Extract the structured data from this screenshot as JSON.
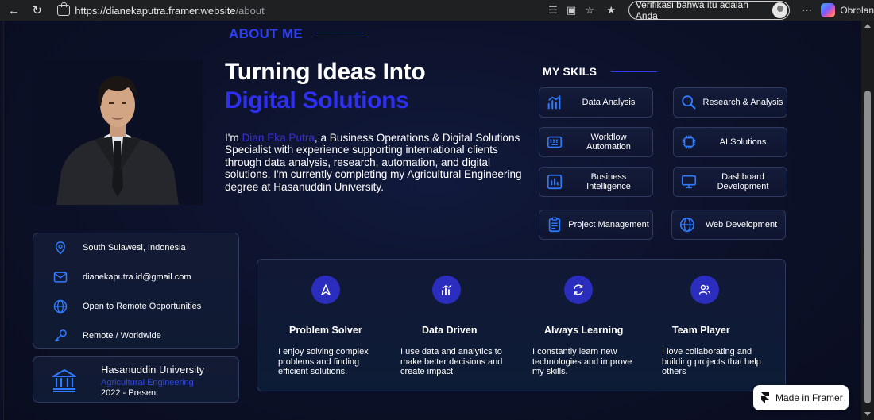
{
  "browser": {
    "url_host": "https://dianekaputra.framer.website",
    "url_path": "/about",
    "verify_label": "Verifikasi bahwa itu adalah Anda",
    "copilot_label": "Obrolan"
  },
  "about": {
    "section_title": "ABOUT ME",
    "headline_line1": "Turning Ideas Into",
    "headline_line2": "Digital Solutions",
    "bio_prefix": "I'm ",
    "bio_name": "Dian Eka Putra",
    "bio_text": ", a Business Operations & Digital Solutions Specialist with experience supporting international clients through data analysis, research, automation, and digital solutions. I'm currently completing my Agricultural Engineering degree at Hasanuddin University."
  },
  "skills": {
    "title": "MY SKILS",
    "items": [
      {
        "label": "Data Analysis",
        "icon": "chart-icon"
      },
      {
        "label": "Research & Analysis",
        "icon": "search-icon"
      },
      {
        "label": "Workflow Automation",
        "icon": "keyboard-icon"
      },
      {
        "label": "AI Solutions",
        "icon": "chip-icon"
      },
      {
        "label": "Business Intelligence",
        "icon": "bar-chart-icon"
      },
      {
        "label": "Dashboard Development",
        "icon": "monitor-icon"
      },
      {
        "label": "Project Management",
        "icon": "clipboard-icon"
      },
      {
        "label": "Web Development",
        "icon": "globe-icon"
      }
    ]
  },
  "contact": {
    "location": "South Sulawesi, Indonesia",
    "email": "dianekaputra.id@gmail.com",
    "availability": "Open to Remote Opportunities",
    "work_mode": "Remote / Worldwide"
  },
  "education": {
    "school": "Hasanuddin University",
    "major": "Agricultural Engineering",
    "years": "2022 - Present"
  },
  "traits": [
    {
      "title": "Problem Solver",
      "desc": "I enjoy solving complex problems and finding efficient solutions.",
      "icon": "compass-icon"
    },
    {
      "title": "Data Driven",
      "desc": "I use data and analytics to make better decisions and create impact.",
      "icon": "chart-icon"
    },
    {
      "title": "Always Learning",
      "desc": "I constantly learn new technologies and improve my skills.",
      "icon": "refresh-icon"
    },
    {
      "title": "Team Player",
      "desc": "I love collaborating and building projects that help others",
      "icon": "users-icon"
    }
  ],
  "framer_badge": "Made in Framer",
  "colors": {
    "accent": "#2f2ff0",
    "background": "#0d1024",
    "card_border": "#2e3a62"
  }
}
